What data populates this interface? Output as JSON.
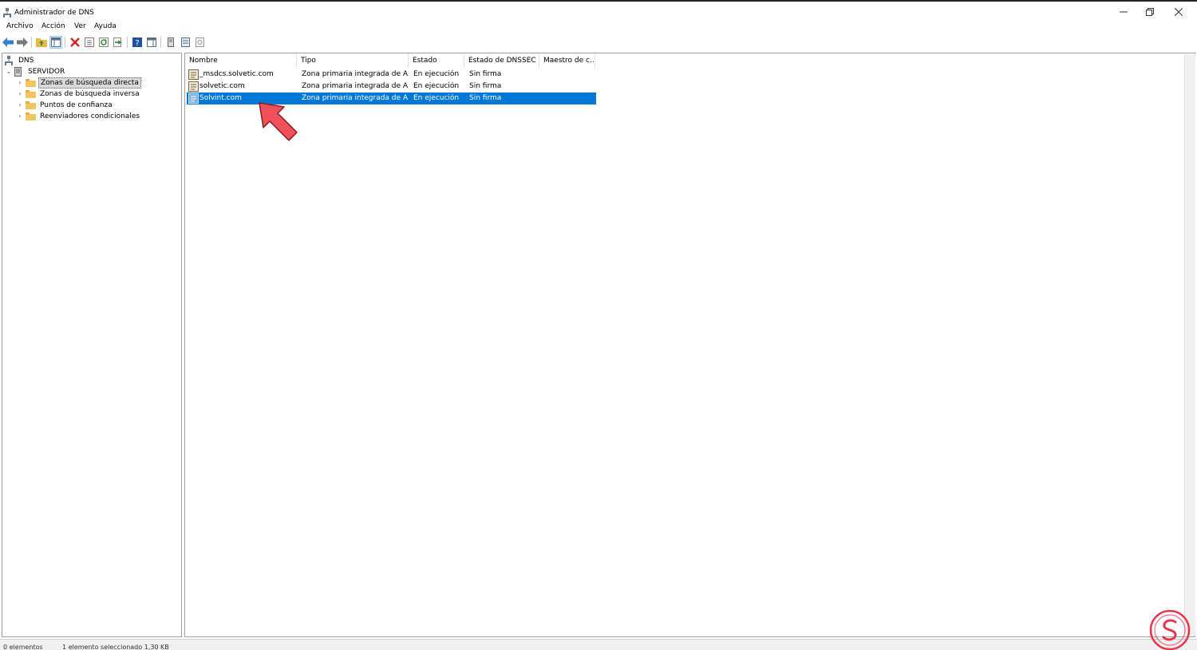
{
  "window": {
    "title": "Administrador de DNS"
  },
  "menu": [
    "Archivo",
    "Acción",
    "Ver",
    "Ayuda"
  ],
  "toolbar": {
    "icons": [
      "back-arrow-icon",
      "forward-arrow-icon",
      "up-folder-icon",
      "show-tree-icon",
      "delete-icon",
      "properties-icon",
      "refresh-icon",
      "export-icon",
      "help-icon",
      "action-pane-icon",
      "server-icon",
      "list-view-icon",
      "detail-view-icon"
    ]
  },
  "tree": {
    "root": "DNS",
    "server": "SERVIDOR",
    "items": [
      {
        "label": "Zonas de búsqueda directa",
        "selected": true
      },
      {
        "label": "Zonas de búsqueda inversa",
        "selected": false
      },
      {
        "label": "Puntos de confianza",
        "selected": false
      },
      {
        "label": "Reenviadores condicionales",
        "selected": false
      }
    ]
  },
  "list": {
    "columns": [
      "Nombre",
      "Tipo",
      "Estado",
      "Estado de DNSSEC",
      "Maestro de c..."
    ],
    "rows": [
      {
        "name": "_msdcs.solvetic.com",
        "type": "Zona primaria integrada de A...",
        "status": "En ejecución",
        "dnssec": "Sin firma",
        "master": "",
        "selected": false
      },
      {
        "name": "solvetic.com",
        "type": "Zona primaria integrada de A...",
        "status": "En ejecución",
        "dnssec": "Sin firma",
        "master": "",
        "selected": false
      },
      {
        "name": "Solvint.com",
        "type": "Zona primaria integrada de A...",
        "status": "En ejecución",
        "dnssec": "Sin firma",
        "master": "",
        "selected": true
      }
    ]
  },
  "statusbar": {
    "left": "0 elementos",
    "middle": "1 elemento seleccionado   1,30 KB"
  },
  "colors": {
    "selection": "#0078d7",
    "annotation_arrow": "#f0505a",
    "watermark": "#e8334a"
  }
}
